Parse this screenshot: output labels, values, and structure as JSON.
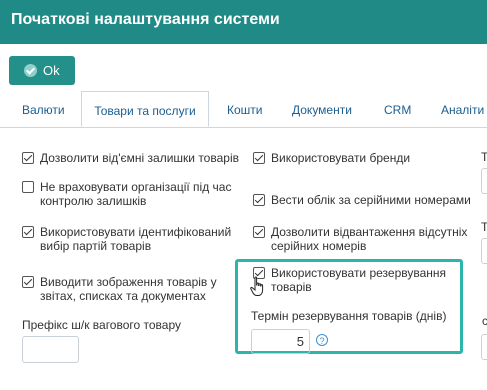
{
  "window": {
    "title": "Початкові налаштування системи"
  },
  "toolbar": {
    "ok_label": "Ok"
  },
  "tabs": [
    {
      "label": "Валюти",
      "active": false
    },
    {
      "label": "Товари та послуги",
      "active": true
    },
    {
      "label": "Кошти",
      "active": false
    },
    {
      "label": "Документи",
      "active": false
    },
    {
      "label": "CRM",
      "active": false
    },
    {
      "label": "Аналіти",
      "active": false
    }
  ],
  "col1": {
    "options": [
      {
        "label_lines": [
          "Дозволити від'ємні залишки товарів"
        ],
        "checked": true
      },
      {
        "label_lines": [
          "Не враховувати організації під час",
          "контролю залишків"
        ],
        "checked": false
      },
      {
        "label_lines": [
          "Використовувати ідентифікований",
          "вибір партій товарів"
        ],
        "checked": true
      },
      {
        "label_lines": [
          "Виводити зображення товарів у",
          "звітах, списках та документах"
        ],
        "checked": true
      }
    ],
    "weight_prefix_label": "Префікс ш/к вагового товару",
    "weight_prefix_value": ""
  },
  "col2": {
    "options": [
      {
        "label_lines": [
          "Використовувати бренди"
        ],
        "checked": true
      },
      {
        "label_lines": [
          "Вести облік за серійними номерами"
        ],
        "checked": true
      },
      {
        "label_lines": [
          "Дозволити відвантаження відсутніх",
          "серійних номерів"
        ],
        "checked": true
      },
      {
        "label_lines": [
          "Використовувати резервування",
          "товарів"
        ],
        "checked": true
      }
    ],
    "reserve_term_label": "Термін резервування товарів (днів)",
    "reserve_term_value": "5",
    "help_symbol": "?"
  },
  "col3": {
    "cut_letters": [
      "Т",
      "Т",
      "с"
    ]
  },
  "colors": {
    "titlebar": "#1f8a86",
    "ok_button": "#24908a",
    "highlight": "#2bb5ad",
    "tab_text": "#1a5d8f"
  },
  "icons": {
    "ok": "check-circle-icon",
    "help": "question-circle-icon",
    "cursor": "hand-pointer-icon"
  }
}
